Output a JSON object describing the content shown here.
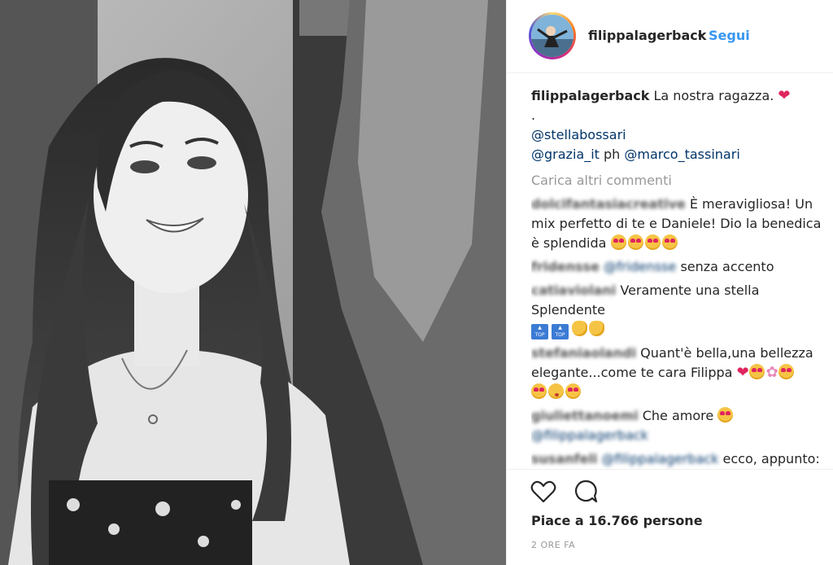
{
  "post": {
    "image_alt": "Foto in bianco e nero di una ragazza che sorride mentre le vengono acconciati i capelli"
  },
  "header": {
    "username": "filippalagerback",
    "separator": "•",
    "follow_label": "Segui"
  },
  "caption": {
    "username": "filippalagerback",
    "text": "La nostra ragazza.",
    "dot_line": ".",
    "mention1": "@stellabossari",
    "mention2": "@grazia_it",
    "ph": "ph",
    "mention3": "@marco_tassinari"
  },
  "load_more": "Carica altri commenti",
  "comments": [
    {
      "username": "dolcifantasiacreative",
      "text": "È meravigliosa! Un mix perfetto di te e Daniele! Dio la benedica è splendida"
    },
    {
      "username": "fridensse",
      "mention": "@fridensse",
      "text": "senza accento"
    },
    {
      "username": "catiaviolani",
      "text": "Veramente una stella Splendente"
    },
    {
      "username": "stefaniaolandi",
      "text": "Quant'è bella,una bellezza elegante...come te cara Filippa"
    },
    {
      "username": "giuliettanoemi",
      "text": "Che amore",
      "mention": "@filippalagerback"
    },
    {
      "username": "susanfeli",
      "mention": "@filippalagerback",
      "text": "ecco, appunto:"
    }
  ],
  "footer": {
    "likes": "Piace a 16.766 persone",
    "time": "2 ORE FA"
  },
  "icons": {
    "like": "heart-outline-icon",
    "comment": "speech-bubble-icon"
  },
  "colors": {
    "link": "#003569",
    "follow": "#3897f0",
    "muted": "#999999"
  }
}
